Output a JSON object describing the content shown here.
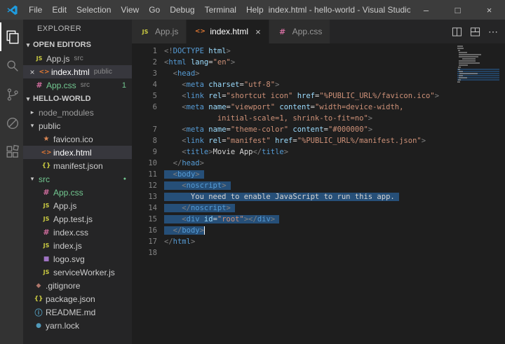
{
  "colors": {
    "selection": "#264f78",
    "git_green": "#73c991",
    "titlebar_bg": "#3c3c3c",
    "editor_bg": "#1e1e1e",
    "sidebar_bg": "#252526"
  },
  "title_bar": {
    "title": "index.html - hello-world - Visual Studio Code",
    "menus": [
      "File",
      "Edit",
      "Selection",
      "View",
      "Go",
      "Debug",
      "Terminal",
      "Help"
    ],
    "window_controls": [
      {
        "name": "minimize-button",
        "glyph": "–"
      },
      {
        "name": "maximize-button",
        "glyph": "□"
      },
      {
        "name": "close-button",
        "glyph": "×"
      }
    ]
  },
  "activity_bar": {
    "items": [
      {
        "name": "explorer-icon",
        "key": "explorer",
        "active": true
      },
      {
        "name": "search-icon",
        "key": "search",
        "active": false
      },
      {
        "name": "source-control-icon",
        "key": "scm",
        "active": false
      },
      {
        "name": "debug-icon",
        "key": "debug",
        "active": false
      },
      {
        "name": "extensions-icon",
        "key": "extensions",
        "active": false
      }
    ]
  },
  "icons": {
    "js": {
      "glyph": "JS",
      "color": "#cbcb41",
      "size": 8
    },
    "html": {
      "glyph": "<>",
      "color": "#e37933",
      "size": 9
    },
    "css": {
      "glyph": "#",
      "color": "#d16d9e",
      "size": 11
    },
    "json": {
      "glyph": "{}",
      "color": "#cbcb41",
      "size": 9
    },
    "md": {
      "glyph": "ⓘ",
      "color": "#519aba",
      "size": 11
    },
    "favicon": {
      "glyph": "★",
      "color": "#dd8855",
      "size": 10
    },
    "svg": {
      "glyph": "■",
      "color": "#a074c4",
      "size": 9
    },
    "git": {
      "glyph": "◆",
      "color": "#b0776b",
      "size": 9
    },
    "lock": {
      "glyph": "●",
      "color": "#519aba",
      "size": 9
    },
    "close": "×",
    "more": "⋯",
    "chevron_expanded": "▾",
    "chevron_collapsed": "▸"
  },
  "sidebar": {
    "header": "EXPLORER",
    "open_editors": {
      "label": "OPEN EDITORS",
      "items": [
        {
          "name": "App.js",
          "detail": "src",
          "icon": "js",
          "active": false
        },
        {
          "name": "index.html",
          "detail": "public",
          "icon": "html",
          "active": true
        },
        {
          "name": "App.css",
          "detail": "src",
          "icon": "css",
          "active": false,
          "green": true,
          "badge": "1"
        }
      ]
    },
    "project": {
      "label": "HELLO-WORLD",
      "tree": [
        {
          "label": "node_modules",
          "type": "folder",
          "expanded": false,
          "indent": 0,
          "muted": true
        },
        {
          "label": "public",
          "type": "folder",
          "expanded": true,
          "indent": 0
        },
        {
          "label": "favicon.ico",
          "icon": "favicon",
          "indent": 1
        },
        {
          "label": "index.html",
          "icon": "html",
          "indent": 1,
          "selected": true
        },
        {
          "label": "manifest.json",
          "icon": "json",
          "indent": 1
        },
        {
          "label": "src",
          "type": "folder",
          "expanded": true,
          "indent": 0,
          "green": true,
          "dot": true
        },
        {
          "label": "App.css",
          "icon": "css",
          "indent": 1,
          "green": true
        },
        {
          "label": "App.js",
          "icon": "js",
          "indent": 1
        },
        {
          "label": "App.test.js",
          "icon": "js",
          "indent": 1
        },
        {
          "label": "index.css",
          "icon": "css",
          "indent": 1
        },
        {
          "label": "index.js",
          "icon": "js",
          "indent": 1
        },
        {
          "label": "logo.svg",
          "icon": "svg",
          "indent": 1
        },
        {
          "label": "serviceWorker.js",
          "icon": "js",
          "indent": 1
        },
        {
          "label": ".gitignore",
          "icon": "git",
          "indent": 0
        },
        {
          "label": "package.json",
          "icon": "json",
          "indent": 0
        },
        {
          "label": "README.md",
          "icon": "md",
          "indent": 0
        },
        {
          "label": "yarn.lock",
          "icon": "lock",
          "indent": 0
        }
      ]
    }
  },
  "tab_bar": {
    "tabs": [
      {
        "label": "App.js",
        "icon": "js",
        "active": false
      },
      {
        "label": "index.html",
        "icon": "html",
        "active": true
      },
      {
        "label": "App.css",
        "icon": "css",
        "active": false
      }
    ],
    "actions": [
      {
        "name": "split-editor-icon",
        "key": "split"
      },
      {
        "name": "editor-layout-icon",
        "key": "layout"
      },
      {
        "name": "more-actions-icon",
        "key": "more"
      }
    ]
  },
  "editor": {
    "language": "html",
    "lines": [
      {
        "n": "1",
        "tk": [
          [
            "p",
            "<!"
          ],
          [
            "t",
            "DOCTYPE"
          ],
          [
            "a",
            " html"
          ],
          [
            "p",
            ">"
          ]
        ]
      },
      {
        "n": "2",
        "tk": [
          [
            "p",
            "<"
          ],
          [
            "t",
            "html"
          ],
          [
            "a",
            " lang"
          ],
          [
            "x",
            "="
          ],
          [
            "v",
            "\"en\""
          ],
          [
            "p",
            ">"
          ]
        ]
      },
      {
        "n": "3",
        "tk": [
          [
            "x",
            "  "
          ],
          [
            "p",
            "<"
          ],
          [
            "t",
            "head"
          ],
          [
            "p",
            ">"
          ]
        ]
      },
      {
        "n": "4",
        "tk": [
          [
            "x",
            "    "
          ],
          [
            "p",
            "<"
          ],
          [
            "t",
            "meta"
          ],
          [
            "a",
            " charset"
          ],
          [
            "x",
            "="
          ],
          [
            "v",
            "\"utf-8\""
          ],
          [
            "p",
            ">"
          ]
        ]
      },
      {
        "n": "5",
        "tk": [
          [
            "x",
            "    "
          ],
          [
            "p",
            "<"
          ],
          [
            "t",
            "link"
          ],
          [
            "a",
            " rel"
          ],
          [
            "x",
            "="
          ],
          [
            "v",
            "\"shortcut icon\""
          ],
          [
            "a",
            " href"
          ],
          [
            "x",
            "="
          ],
          [
            "v",
            "\"%PUBLIC_URL%/favicon.ico\""
          ],
          [
            "p",
            ">"
          ]
        ]
      },
      {
        "n": "6",
        "tk": [
          [
            "x",
            "    "
          ],
          [
            "p",
            "<"
          ],
          [
            "t",
            "meta"
          ],
          [
            "a",
            " name"
          ],
          [
            "x",
            "="
          ],
          [
            "v",
            "\"viewport\""
          ],
          [
            "a",
            " content"
          ],
          [
            "x",
            "="
          ],
          [
            "v",
            "\"width=device-width,"
          ]
        ]
      },
      {
        "n": "",
        "tk": [
          [
            "x",
            "            "
          ],
          [
            "v",
            "initial-scale=1, shrink-to-fit=no\""
          ],
          [
            "p",
            ">"
          ]
        ]
      },
      {
        "n": "7",
        "tk": [
          [
            "x",
            "    "
          ],
          [
            "p",
            "<"
          ],
          [
            "t",
            "meta"
          ],
          [
            "a",
            " name"
          ],
          [
            "x",
            "="
          ],
          [
            "v",
            "\"theme-color\""
          ],
          [
            "a",
            " content"
          ],
          [
            "x",
            "="
          ],
          [
            "v",
            "\"#000000\""
          ],
          [
            "p",
            ">"
          ]
        ]
      },
      {
        "n": "8",
        "tk": [
          [
            "x",
            "    "
          ],
          [
            "p",
            "<"
          ],
          [
            "t",
            "link"
          ],
          [
            "a",
            " rel"
          ],
          [
            "x",
            "="
          ],
          [
            "v",
            "\"manifest\""
          ],
          [
            "a",
            " href"
          ],
          [
            "x",
            "="
          ],
          [
            "v",
            "\"%PUBLIC_URL%/manifest.json\""
          ],
          [
            "p",
            ">"
          ]
        ]
      },
      {
        "n": "9",
        "tk": [
          [
            "x",
            "    "
          ],
          [
            "p",
            "<"
          ],
          [
            "t",
            "title"
          ],
          [
            "p",
            ">"
          ],
          [
            "x",
            "Movie App"
          ],
          [
            "p",
            "</"
          ],
          [
            "t",
            "title"
          ],
          [
            "p",
            ">"
          ]
        ]
      },
      {
        "n": "10",
        "tk": [
          [
            "x",
            "  "
          ],
          [
            "p",
            "</"
          ],
          [
            "t",
            "head"
          ],
          [
            "p",
            ">"
          ]
        ]
      },
      {
        "n": "11",
        "sel": true,
        "tk": [
          [
            "x",
            "  "
          ],
          [
            "p",
            "<"
          ],
          [
            "t",
            "body"
          ],
          [
            "p",
            ">"
          ]
        ]
      },
      {
        "n": "12",
        "sel": true,
        "tk": [
          [
            "x",
            "    "
          ],
          [
            "p",
            "<"
          ],
          [
            "t",
            "noscript"
          ],
          [
            "p",
            ">"
          ]
        ]
      },
      {
        "n": "13",
        "sel": true,
        "tk": [
          [
            "x",
            "      You need to enable JavaScript to run this app."
          ]
        ]
      },
      {
        "n": "14",
        "sel": true,
        "tk": [
          [
            "x",
            "    "
          ],
          [
            "p",
            "</"
          ],
          [
            "t",
            "noscript"
          ],
          [
            "p",
            ">"
          ]
        ]
      },
      {
        "n": "15",
        "sel": true,
        "tk": [
          [
            "x",
            "    "
          ],
          [
            "p",
            "<"
          ],
          [
            "t",
            "div"
          ],
          [
            "a",
            " id"
          ],
          [
            "x",
            "="
          ],
          [
            "v",
            "\"root\""
          ],
          [
            "p",
            ">"
          ],
          [
            "p",
            "</"
          ],
          [
            "t",
            "div"
          ],
          [
            "p",
            ">"
          ]
        ]
      },
      {
        "n": "16",
        "sel": true,
        "cursor": true,
        "tk": [
          [
            "x",
            "  "
          ],
          [
            "p",
            "</"
          ],
          [
            "t",
            "body"
          ],
          [
            "p",
            ">"
          ]
        ]
      },
      {
        "n": "17",
        "tk": [
          [
            "p",
            "</"
          ],
          [
            "t",
            "html"
          ],
          [
            "p",
            ">"
          ]
        ]
      },
      {
        "n": "18",
        "tk": []
      }
    ]
  }
}
